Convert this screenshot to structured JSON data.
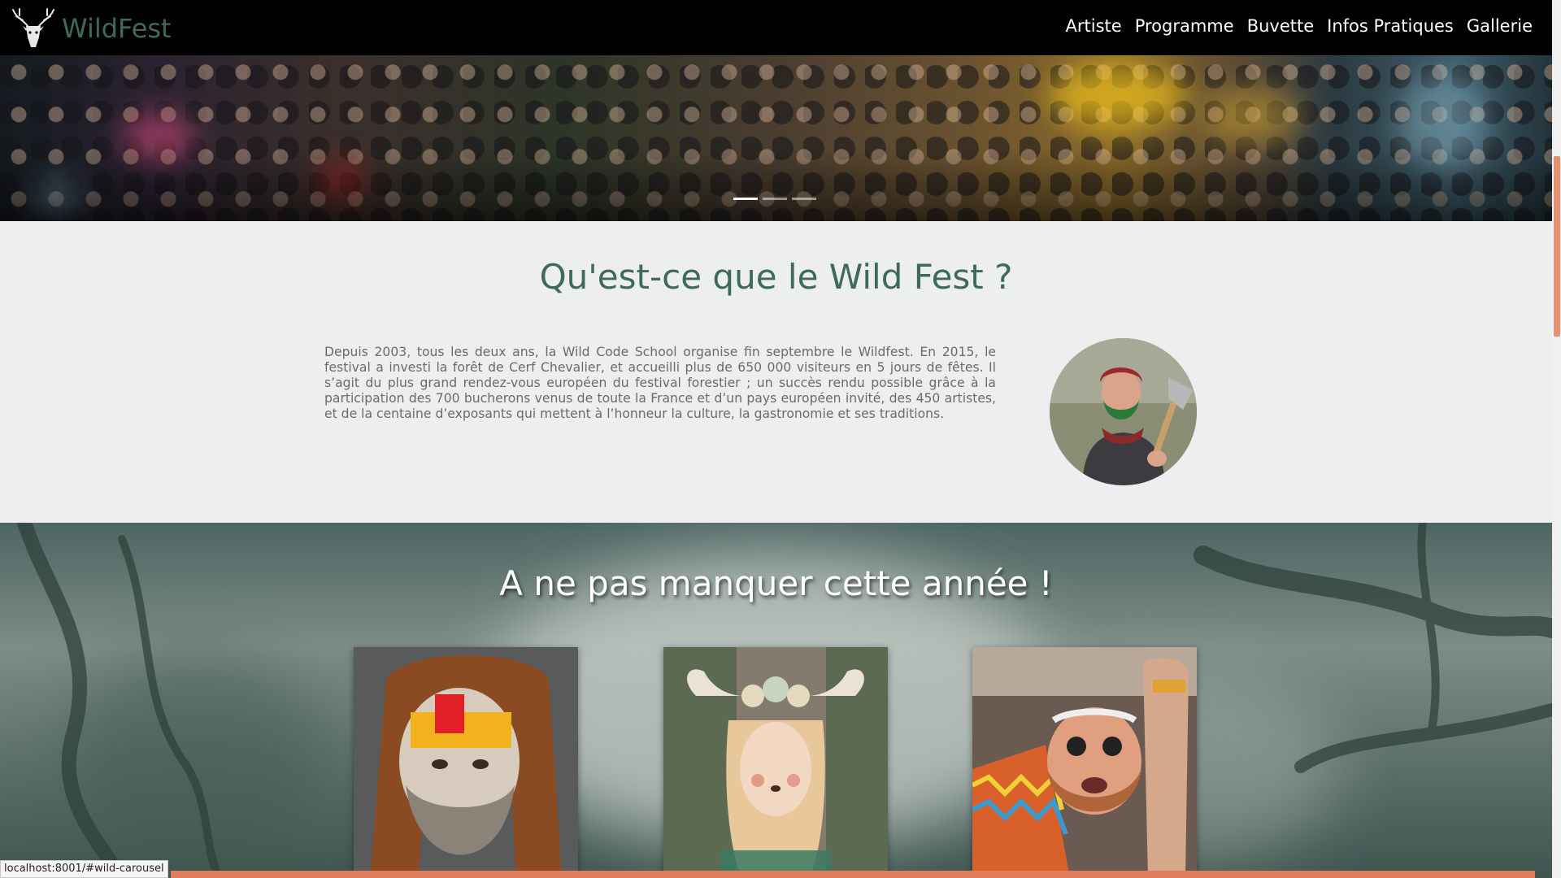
{
  "brand": {
    "name": "WildFest",
    "logo_icon": "deer-head-icon"
  },
  "nav": {
    "items": [
      "Artiste",
      "Programme",
      "Buvette",
      "Infos Pratiques",
      "Gallerie"
    ]
  },
  "hero": {
    "slide_count": 3,
    "active_slide": 1
  },
  "about": {
    "title": "Qu'est-ce que le Wild Fest ?",
    "text": "Depuis 2003, tous les deux ans, la Wild Code School organise fin septembre le Wildfest. En 2015, le festival a investi la forêt de Cerf Chevalier, et accueilli plus de 650 000 visiteurs en 5 jours de fêtes. Il s’agit du plus grand rendez-vous européen du festival forestier ; un succès rendu possible grâce à la participation des 700 bucherons venus de toute la France et d’un pays européen invité, des 450 artistes, et de la centaine d’exposants qui mettent à l’honneur la culture, la gastronomie et ses traditions."
  },
  "highlights": {
    "title": "A ne pas manquer cette année !"
  },
  "status_bar": {
    "url": "localhost:8001/#wild-carousel"
  },
  "colors": {
    "brand": "#3f6a5a",
    "accent": "#e07e5c",
    "navbar": "#000000",
    "section_bg": "#eceeef"
  }
}
